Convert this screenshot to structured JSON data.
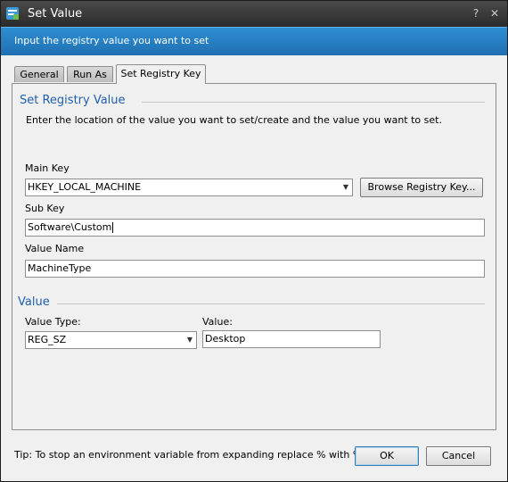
{
  "window": {
    "title": "Set Value",
    "help_symbol": "?",
    "close_symbol": "✕"
  },
  "banner": {
    "text": "Input the registry value you want to set"
  },
  "tabs": [
    {
      "label": "General",
      "active": false
    },
    {
      "label": "Run As",
      "active": false
    },
    {
      "label": "Set Registry Key",
      "active": true
    }
  ],
  "registry_section": {
    "title": "Set Registry Value",
    "instruction": "Enter the location of the value you want to set/create and the value you want to set.",
    "main_key": {
      "label": "Main Key",
      "value": "HKEY_LOCAL_MACHINE",
      "arrow": "▼"
    },
    "browse_button": "Browse Registry Key...",
    "sub_key": {
      "label": "Sub Key",
      "value": "Software\\Custom"
    },
    "value_name": {
      "label": "Value Name",
      "value": "MachineType"
    }
  },
  "value_section": {
    "title": "Value",
    "value_type": {
      "label": "Value Type:",
      "value": "REG_SZ",
      "arrow": "▼"
    },
    "value": {
      "label": "Value:",
      "value": "Desktop"
    }
  },
  "footer": {
    "tip": "Tip: To stop an environment variable from expanding replace % with %%.",
    "ok_label": "OK",
    "cancel_label": "Cancel"
  },
  "colors": {
    "banner": "#2479c0",
    "section_title": "#1f5fae",
    "titlebar": "#333333"
  }
}
